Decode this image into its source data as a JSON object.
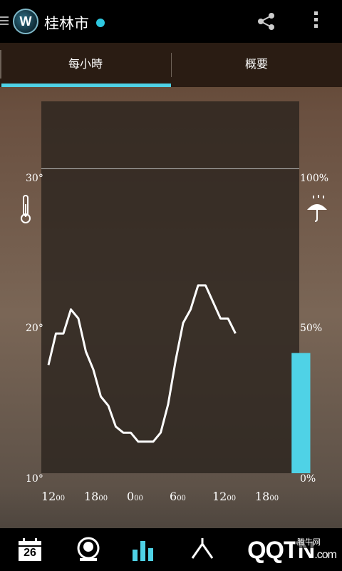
{
  "header": {
    "menu_icon": "hamburger-icon",
    "logo_text": "W",
    "city": "桂林市",
    "location_dot_color": "#2ec8e0",
    "share_icon": "share-icon",
    "overflow_icon": "overflow-menu-icon"
  },
  "tabs": [
    {
      "label": "每小時",
      "selected": true
    },
    {
      "label": "概要",
      "selected": false
    }
  ],
  "accent_color": "#4fd2e6",
  "chart_data": {
    "type": "line",
    "title": "",
    "x_ticks": [
      {
        "main": "12",
        "sub": "00"
      },
      {
        "main": "18",
        "sub": "00"
      },
      {
        "main": "0",
        "sub": "00"
      },
      {
        "main": "6",
        "sub": "00"
      },
      {
        "main": "12",
        "sub": "00"
      },
      {
        "main": "18",
        "sub": "00"
      }
    ],
    "left_axis": {
      "ticks": [
        "30°",
        "20°",
        "10°"
      ],
      "range": [
        10,
        30
      ],
      "icon": "thermometer-icon"
    },
    "right_axis": {
      "ticks": [
        "100%",
        "50%",
        "0%"
      ],
      "range": [
        0,
        100
      ],
      "icon": "umbrella-rain-icon"
    },
    "temperature_hours": [
      12,
      13,
      14,
      15,
      16,
      17,
      18,
      19,
      20,
      21,
      22,
      23,
      24,
      25,
      26,
      27,
      28,
      29,
      30,
      31,
      32,
      33,
      34,
      35,
      36,
      37,
      38,
      39,
      40,
      41,
      42,
      43,
      44,
      45,
      46,
      47
    ],
    "temperature": [
      17.2,
      19.3,
      19.3,
      20.9,
      20.3,
      18.1,
      16.9,
      15.1,
      14.5,
      13.1,
      12.7,
      12.7,
      12.1,
      12.1,
      12.1,
      12.7,
      14.6,
      17.5,
      20,
      20.9,
      22.5,
      22.5,
      21.4,
      20.3,
      20.3,
      19.3
    ],
    "precipitation": [
      {
        "x_start": 44.5,
        "x_end": 47,
        "value": 40
      }
    ],
    "max_line": 29.0
  },
  "bottom_nav": [
    {
      "name": "calendar-icon",
      "label": "26"
    },
    {
      "name": "current-weather-icon",
      "label": ""
    },
    {
      "name": "hourly-chart-icon",
      "label": ""
    },
    {
      "name": "radar-icon",
      "label": ""
    }
  ],
  "watermark": {
    "main": "QQTN",
    "suffix": ".com",
    "badge": "腾牛网"
  }
}
